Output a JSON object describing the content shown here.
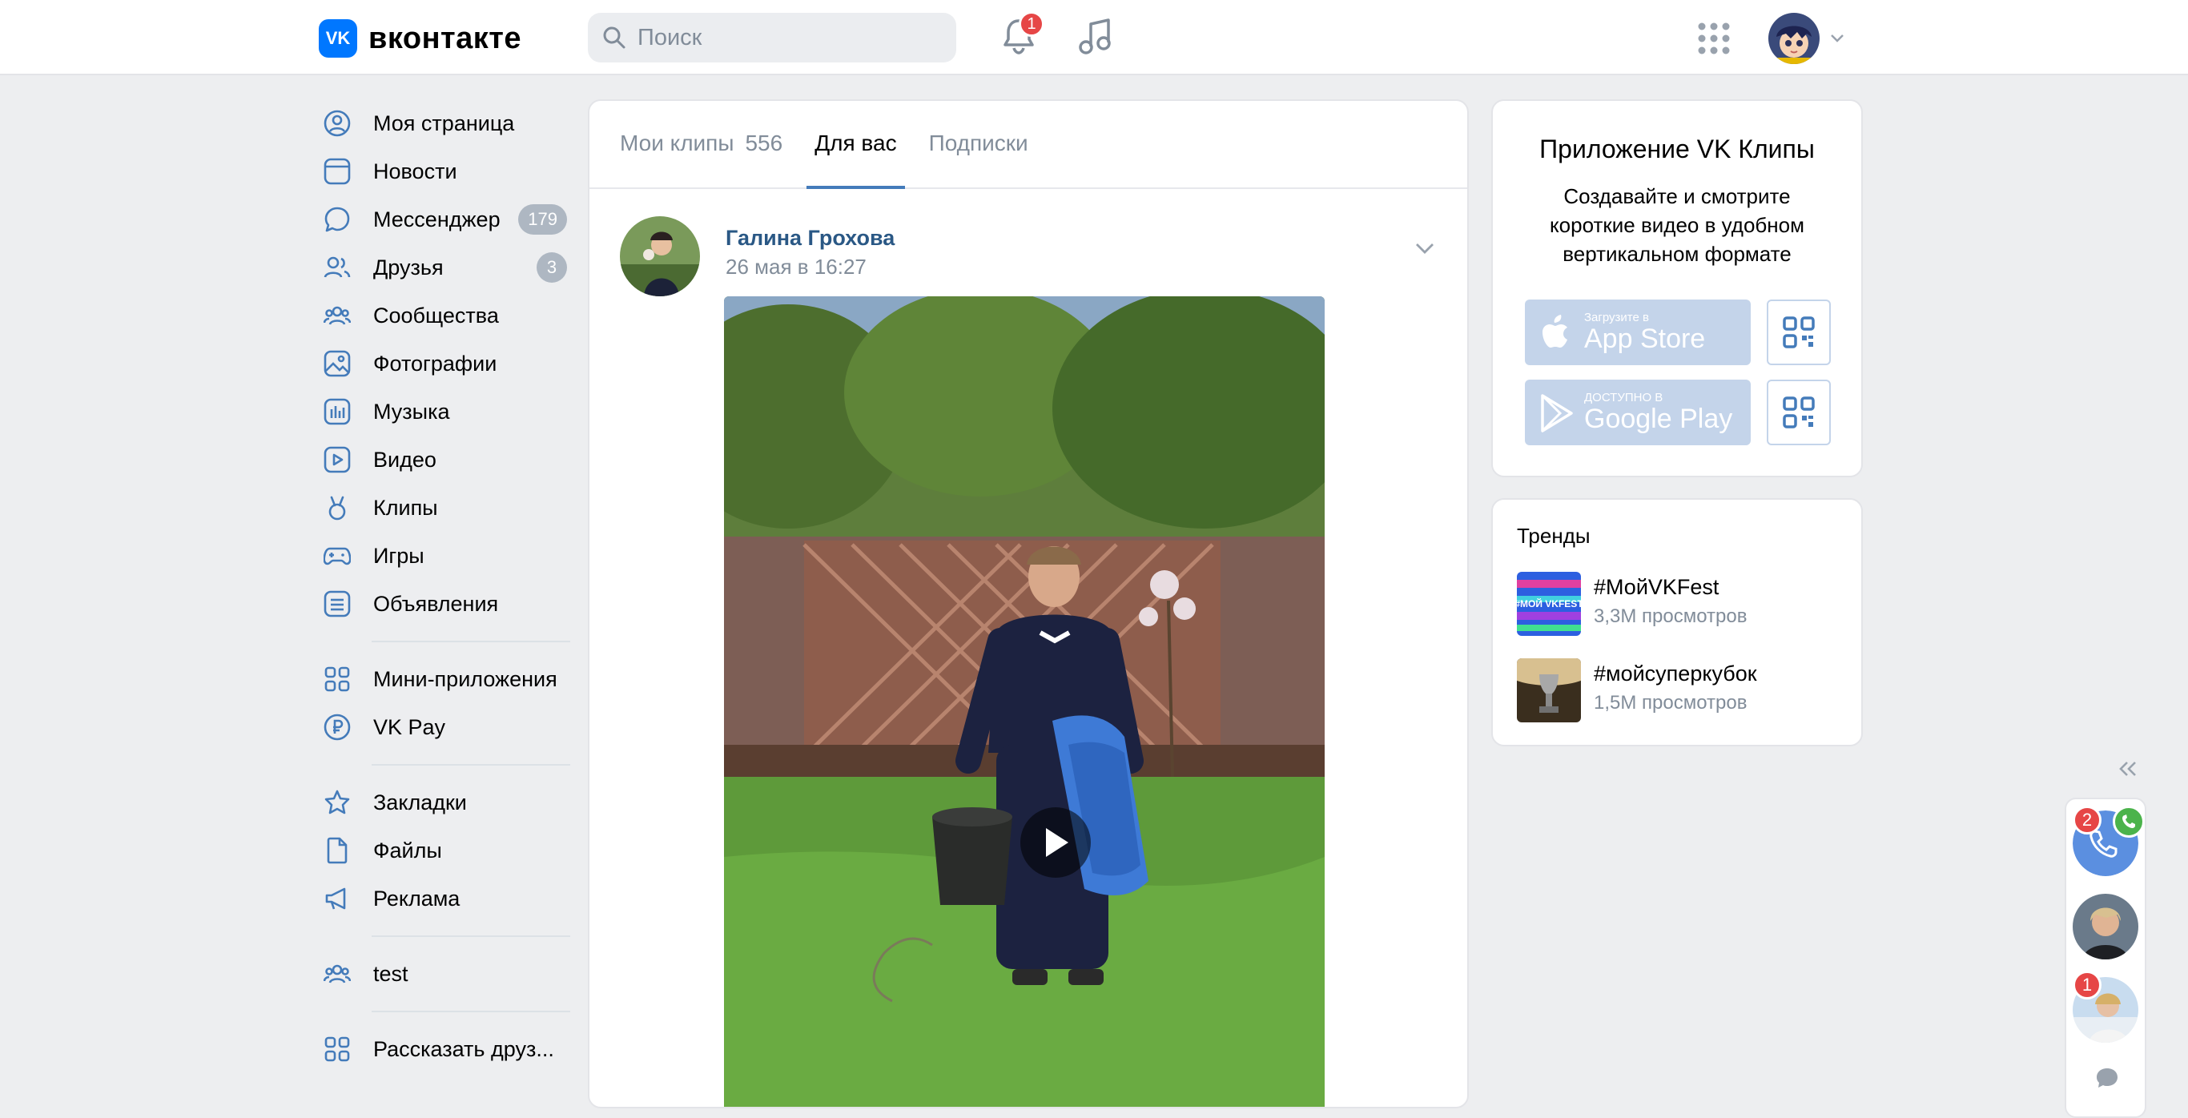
{
  "header": {
    "logo_text": "вконтакте",
    "logo_mark": "VK",
    "search_placeholder": "Поиск",
    "notifications_count": "1"
  },
  "sidebar": {
    "items": [
      {
        "label": "Моя страница",
        "icon": "user-circle-icon"
      },
      {
        "label": "Новости",
        "icon": "news-icon"
      },
      {
        "label": "Мессенджер",
        "icon": "message-icon",
        "count": "179"
      },
      {
        "label": "Друзья",
        "icon": "friends-icon",
        "count": "3"
      },
      {
        "label": "Сообщества",
        "icon": "communities-icon"
      },
      {
        "label": "Фотографии",
        "icon": "photo-icon"
      },
      {
        "label": "Музыка",
        "icon": "music-icon"
      },
      {
        "label": "Видео",
        "icon": "video-icon"
      },
      {
        "label": "Клипы",
        "icon": "clips-icon"
      },
      {
        "label": "Игры",
        "icon": "games-icon"
      },
      {
        "label": "Объявления",
        "icon": "classifieds-icon"
      }
    ],
    "items2": [
      {
        "label": "Мини-приложения",
        "icon": "mini-apps-icon"
      },
      {
        "label": "VK Pay",
        "icon": "vk-pay-icon"
      }
    ],
    "items3": [
      {
        "label": "Закладки",
        "icon": "bookmark-star-icon"
      },
      {
        "label": "Файлы",
        "icon": "file-icon"
      },
      {
        "label": "Реклама",
        "icon": "megaphone-icon"
      }
    ],
    "items4": [
      {
        "label": "test",
        "icon": "group-icon"
      }
    ],
    "items5": [
      {
        "label": "Рассказать друз...",
        "icon": "apps-grid-icon"
      }
    ]
  },
  "feed": {
    "tabs": [
      {
        "label": "Мои клипы",
        "count": "556"
      },
      {
        "label": "Для вас"
      },
      {
        "label": "Подписки"
      }
    ],
    "active_tab": 1,
    "post": {
      "author": "Галина Грохова",
      "date": "26 мая в 16:27"
    }
  },
  "app_promo": {
    "title": "Приложение VK Клипы",
    "description": "Создавайте и смотрите короткие видео в удобном вертикальном формате",
    "appstore_small": "Загрузите в",
    "appstore_big": "App Store",
    "googleplay_small": "ДОСТУПНО В",
    "googleplay_big": "Google Play"
  },
  "trends": {
    "title": "Тренды",
    "items": [
      {
        "tag": "#МойVKFest",
        "views": "3,3M просмотров",
        "thumb_text": "#МОЙ VKFEST"
      },
      {
        "tag": "#мойсуперкубок",
        "views": "1,5M просмотров"
      }
    ]
  },
  "chat": {
    "call_badge": "2",
    "third_badge": "1"
  },
  "colors": {
    "accent": "#447bba",
    "link": "#2a5885",
    "badge": "#e64646",
    "secondary_text": "#818c99",
    "background": "#edeef0"
  }
}
